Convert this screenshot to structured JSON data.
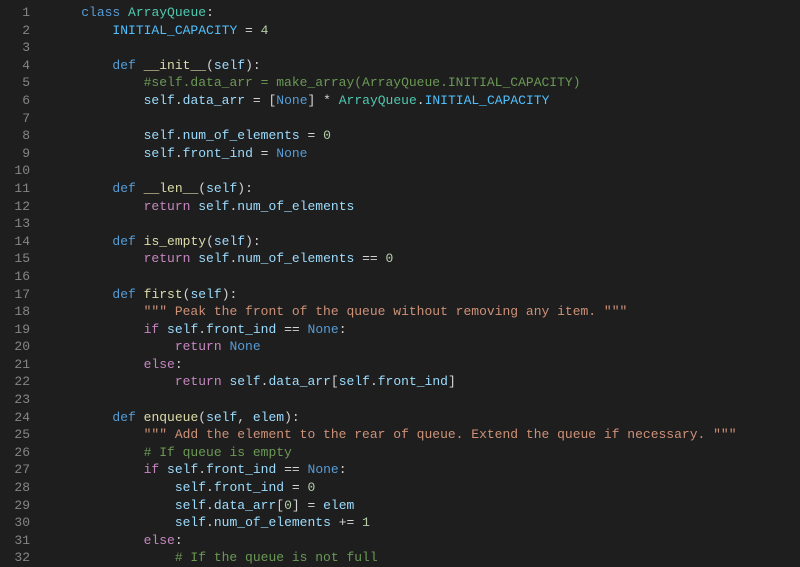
{
  "lines": [
    {
      "n": "1",
      "tokens": [
        [
          "    ",
          "punct"
        ],
        [
          "class",
          " kw-class"
        ],
        [
          " ",
          "punct"
        ],
        [
          "ArrayQueue",
          "classname"
        ],
        [
          ":",
          "punct"
        ]
      ]
    },
    {
      "n": "2",
      "tokens": [
        [
          "        ",
          "punct"
        ],
        [
          "INITIAL_CAPACITY",
          "const"
        ],
        [
          " = ",
          "op"
        ],
        [
          "4",
          "num"
        ]
      ]
    },
    {
      "n": "3",
      "tokens": [
        [
          "",
          "punct"
        ]
      ]
    },
    {
      "n": "4",
      "tokens": [
        [
          "        ",
          "punct"
        ],
        [
          "def",
          "kw-def"
        ],
        [
          " ",
          "punct"
        ],
        [
          "__init__",
          "funcname"
        ],
        [
          "(",
          "punct"
        ],
        [
          "self",
          "param"
        ],
        [
          "):",
          "punct"
        ]
      ]
    },
    {
      "n": "5",
      "tokens": [
        [
          "            ",
          "punct"
        ],
        [
          "#self.data_arr = make_array(ArrayQueue.INITIAL_CAPACITY)",
          "comment"
        ]
      ]
    },
    {
      "n": "6",
      "tokens": [
        [
          "            ",
          "punct"
        ],
        [
          "self",
          "kw-self"
        ],
        [
          ".",
          "punct"
        ],
        [
          "data_arr",
          "ident"
        ],
        [
          " = [",
          "op"
        ],
        [
          "None",
          "kw-none"
        ],
        [
          "] * ",
          "op"
        ],
        [
          "ArrayQueue",
          "classname"
        ],
        [
          ".",
          "punct"
        ],
        [
          "INITIAL_CAPACITY",
          "const"
        ]
      ]
    },
    {
      "n": "7",
      "tokens": [
        [
          "",
          "punct"
        ]
      ]
    },
    {
      "n": "8",
      "tokens": [
        [
          "            ",
          "punct"
        ],
        [
          "self",
          "kw-self"
        ],
        [
          ".",
          "punct"
        ],
        [
          "num_of_elements",
          "ident"
        ],
        [
          " = ",
          "op"
        ],
        [
          "0",
          "num"
        ]
      ]
    },
    {
      "n": "9",
      "tokens": [
        [
          "            ",
          "punct"
        ],
        [
          "self",
          "kw-self"
        ],
        [
          ".",
          "punct"
        ],
        [
          "front_ind",
          "ident"
        ],
        [
          " = ",
          "op"
        ],
        [
          "None",
          "kw-none"
        ]
      ]
    },
    {
      "n": "10",
      "tokens": [
        [
          "",
          "punct"
        ]
      ]
    },
    {
      "n": "11",
      "tokens": [
        [
          "        ",
          "punct"
        ],
        [
          "def",
          "kw-def"
        ],
        [
          " ",
          "punct"
        ],
        [
          "__len__",
          "funcname"
        ],
        [
          "(",
          "punct"
        ],
        [
          "self",
          "param"
        ],
        [
          "):",
          "punct"
        ]
      ]
    },
    {
      "n": "12",
      "tokens": [
        [
          "            ",
          "punct"
        ],
        [
          "return",
          "kw-return"
        ],
        [
          " ",
          "punct"
        ],
        [
          "self",
          "kw-self"
        ],
        [
          ".",
          "punct"
        ],
        [
          "num_of_elements",
          "ident"
        ]
      ]
    },
    {
      "n": "13",
      "tokens": [
        [
          "",
          "punct"
        ]
      ]
    },
    {
      "n": "14",
      "tokens": [
        [
          "        ",
          "punct"
        ],
        [
          "def",
          "kw-def"
        ],
        [
          " ",
          "punct"
        ],
        [
          "is_empty",
          "funcname"
        ],
        [
          "(",
          "punct"
        ],
        [
          "self",
          "param"
        ],
        [
          "):",
          "punct"
        ]
      ]
    },
    {
      "n": "15",
      "tokens": [
        [
          "            ",
          "punct"
        ],
        [
          "return",
          "kw-return"
        ],
        [
          " ",
          "punct"
        ],
        [
          "self",
          "kw-self"
        ],
        [
          ".",
          "punct"
        ],
        [
          "num_of_elements",
          "ident"
        ],
        [
          " == ",
          "op"
        ],
        [
          "0",
          "num"
        ]
      ]
    },
    {
      "n": "16",
      "tokens": [
        [
          "",
          "punct"
        ]
      ]
    },
    {
      "n": "17",
      "tokens": [
        [
          "        ",
          "punct"
        ],
        [
          "def",
          "kw-def"
        ],
        [
          " ",
          "punct"
        ],
        [
          "first",
          "funcname"
        ],
        [
          "(",
          "punct"
        ],
        [
          "self",
          "param"
        ],
        [
          "):",
          "punct"
        ]
      ]
    },
    {
      "n": "18",
      "tokens": [
        [
          "            ",
          "punct"
        ],
        [
          "\"\"\" Peak the front of the queue without removing any item. \"\"\"",
          "string"
        ]
      ]
    },
    {
      "n": "19",
      "tokens": [
        [
          "            ",
          "punct"
        ],
        [
          "if",
          "kw-if"
        ],
        [
          " ",
          "punct"
        ],
        [
          "self",
          "kw-self"
        ],
        [
          ".",
          "punct"
        ],
        [
          "front_ind",
          "ident"
        ],
        [
          " == ",
          "op"
        ],
        [
          "None",
          "kw-none"
        ],
        [
          ":",
          "punct"
        ]
      ]
    },
    {
      "n": "20",
      "tokens": [
        [
          "                ",
          "punct"
        ],
        [
          "return",
          "kw-return"
        ],
        [
          " ",
          "punct"
        ],
        [
          "None",
          "kw-none"
        ]
      ]
    },
    {
      "n": "21",
      "tokens": [
        [
          "            ",
          "punct"
        ],
        [
          "else",
          "kw-else"
        ],
        [
          ":",
          "punct"
        ]
      ]
    },
    {
      "n": "22",
      "tokens": [
        [
          "                ",
          "punct"
        ],
        [
          "return",
          "kw-return"
        ],
        [
          " ",
          "punct"
        ],
        [
          "self",
          "kw-self"
        ],
        [
          ".",
          "punct"
        ],
        [
          "data_arr",
          "ident"
        ],
        [
          "[",
          "punct"
        ],
        [
          "self",
          "kw-self"
        ],
        [
          ".",
          "punct"
        ],
        [
          "front_ind",
          "ident"
        ],
        [
          "]",
          "punct"
        ]
      ]
    },
    {
      "n": "23",
      "tokens": [
        [
          "",
          "punct"
        ]
      ]
    },
    {
      "n": "24",
      "tokens": [
        [
          "        ",
          "punct"
        ],
        [
          "def",
          "kw-def"
        ],
        [
          " ",
          "punct"
        ],
        [
          "enqueue",
          "funcname"
        ],
        [
          "(",
          "punct"
        ],
        [
          "self",
          "param"
        ],
        [
          ", ",
          "punct"
        ],
        [
          "elem",
          "param"
        ],
        [
          "):",
          "punct"
        ]
      ]
    },
    {
      "n": "25",
      "tokens": [
        [
          "            ",
          "punct"
        ],
        [
          "\"\"\" Add the element to the rear of queue. Extend the queue if necessary. \"\"\"",
          "string"
        ]
      ]
    },
    {
      "n": "26",
      "tokens": [
        [
          "            ",
          "punct"
        ],
        [
          "# If queue is empty",
          "comment"
        ]
      ]
    },
    {
      "n": "27",
      "tokens": [
        [
          "            ",
          "punct"
        ],
        [
          "if",
          "kw-if"
        ],
        [
          " ",
          "punct"
        ],
        [
          "self",
          "kw-self"
        ],
        [
          ".",
          "punct"
        ],
        [
          "front_ind",
          "ident"
        ],
        [
          " == ",
          "op"
        ],
        [
          "None",
          "kw-none"
        ],
        [
          ":",
          "punct"
        ]
      ]
    },
    {
      "n": "28",
      "tokens": [
        [
          "                ",
          "punct"
        ],
        [
          "self",
          "kw-self"
        ],
        [
          ".",
          "punct"
        ],
        [
          "front_ind",
          "ident"
        ],
        [
          " = ",
          "op"
        ],
        [
          "0",
          "num"
        ]
      ]
    },
    {
      "n": "29",
      "tokens": [
        [
          "                ",
          "punct"
        ],
        [
          "self",
          "kw-self"
        ],
        [
          ".",
          "punct"
        ],
        [
          "data_arr",
          "ident"
        ],
        [
          "[",
          "punct"
        ],
        [
          "0",
          "num"
        ],
        [
          "] = ",
          "op"
        ],
        [
          "elem",
          "ident"
        ]
      ]
    },
    {
      "n": "30",
      "tokens": [
        [
          "                ",
          "punct"
        ],
        [
          "self",
          "kw-self"
        ],
        [
          ".",
          "punct"
        ],
        [
          "num_of_elements",
          "ident"
        ],
        [
          " += ",
          "op"
        ],
        [
          "1",
          "num"
        ]
      ]
    },
    {
      "n": "31",
      "tokens": [
        [
          "            ",
          "punct"
        ],
        [
          "else",
          "kw-else"
        ],
        [
          ":",
          "punct"
        ]
      ]
    },
    {
      "n": "32",
      "tokens": [
        [
          "                ",
          "punct"
        ],
        [
          "# If the queue is not full",
          "comment"
        ]
      ]
    }
  ]
}
